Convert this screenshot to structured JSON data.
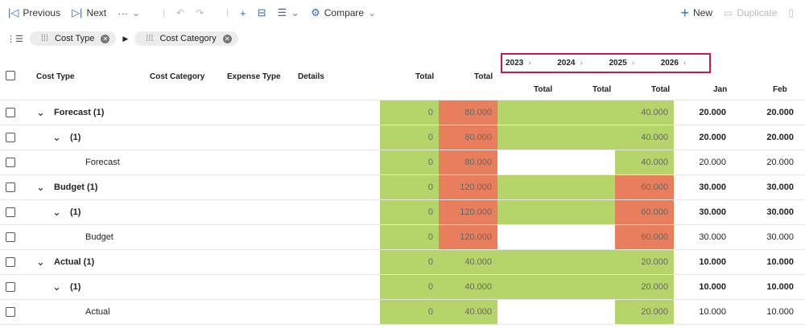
{
  "toolbar": {
    "previous": "Previous",
    "next": "Next",
    "more": "···",
    "compare": "Compare",
    "new": "New",
    "duplicate": "Duplicate"
  },
  "chips": [
    "Cost Type",
    "Cost Category"
  ],
  "headers": {
    "cost_type": "Cost Type",
    "cost_category": "Cost Category",
    "expense_type": "Expense Type",
    "details": "Details",
    "total1": "Total",
    "total2": "Total",
    "y2023": "Total",
    "y2024": "Total",
    "y2025": "Total",
    "jan": "Jan",
    "feb": "Feb"
  },
  "years": [
    "2023",
    "2024",
    "2025",
    "2026"
  ],
  "colors": {
    "g": "#b5d56a",
    "o": "#e97e5d",
    "w": "#ffffff",
    "highlight": "#d3124e"
  },
  "rows": [
    {
      "level": 0,
      "label": "Forecast (1)",
      "bold": true,
      "vals": [
        "0",
        "80.000",
        "",
        "",
        "40.000",
        "20.000",
        "20.000"
      ],
      "fill": [
        "g",
        "o",
        "g",
        "g",
        "g",
        "w",
        "w"
      ]
    },
    {
      "level": 1,
      "label": "(1)",
      "bold": true,
      "vals": [
        "0",
        "80.000",
        "",
        "",
        "40.000",
        "20.000",
        "20.000"
      ],
      "fill": [
        "g",
        "o",
        "g",
        "g",
        "g",
        "w",
        "w"
      ]
    },
    {
      "level": 2,
      "label": "Forecast",
      "bold": false,
      "vals": [
        "0",
        "80.000",
        "",
        "",
        "40.000",
        "20.000",
        "20.000"
      ],
      "fill": [
        "g",
        "o",
        "w",
        "w",
        "g",
        "w",
        "w"
      ]
    },
    {
      "level": 0,
      "label": "Budget (1)",
      "bold": true,
      "vals": [
        "0",
        "120.000",
        "",
        "",
        "60.000",
        "30.000",
        "30.000"
      ],
      "fill": [
        "g",
        "o",
        "g",
        "g",
        "o",
        "w",
        "w"
      ]
    },
    {
      "level": 1,
      "label": "(1)",
      "bold": true,
      "vals": [
        "0",
        "120.000",
        "",
        "",
        "60.000",
        "30.000",
        "30.000"
      ],
      "fill": [
        "g",
        "o",
        "g",
        "g",
        "o",
        "w",
        "w"
      ]
    },
    {
      "level": 2,
      "label": "Budget",
      "bold": false,
      "vals": [
        "0",
        "120.000",
        "",
        "",
        "60.000",
        "30.000",
        "30.000"
      ],
      "fill": [
        "g",
        "o",
        "w",
        "w",
        "o",
        "w",
        "w"
      ]
    },
    {
      "level": 0,
      "label": "Actual (1)",
      "bold": true,
      "vals": [
        "0",
        "40.000",
        "",
        "",
        "20.000",
        "10.000",
        "10.000"
      ],
      "fill": [
        "g",
        "g",
        "g",
        "g",
        "g",
        "w",
        "w"
      ]
    },
    {
      "level": 1,
      "label": "(1)",
      "bold": true,
      "vals": [
        "0",
        "40.000",
        "",
        "",
        "20.000",
        "10.000",
        "10.000"
      ],
      "fill": [
        "g",
        "g",
        "g",
        "g",
        "g",
        "w",
        "w"
      ]
    },
    {
      "level": 2,
      "label": "Actual",
      "bold": false,
      "vals": [
        "0",
        "40.000",
        "",
        "",
        "20.000",
        "10.000",
        "10.000"
      ],
      "fill": [
        "g",
        "g",
        "w",
        "w",
        "g",
        "w",
        "w"
      ]
    }
  ]
}
